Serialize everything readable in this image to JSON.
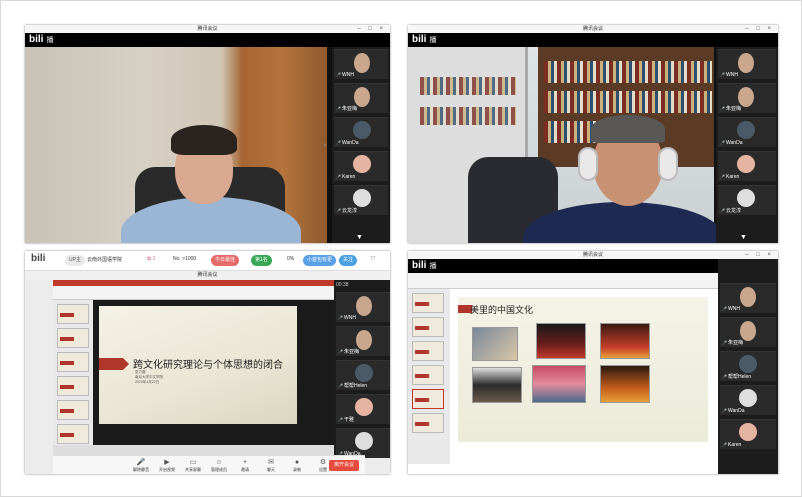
{
  "screens": [
    {
      "window_title": "腾讯会议",
      "bili_logo": "bili",
      "bili_suffix": "播",
      "participants": [
        "WNH",
        "朱亚梅",
        "WanDa",
        "Karen",
        "云龙淳"
      ]
    },
    {
      "window_title": "腾讯会议",
      "bili_logo": "bili",
      "bili_suffix": "播",
      "participants": [
        "WNH",
        "朱亚梅",
        "WanDa",
        "Karen",
        "云龙淳"
      ]
    },
    {
      "bili_logo": "bili",
      "live_badge": "UP主",
      "room_name": "云南外国语学院",
      "count_left": "1",
      "count_no": "No. >1000",
      "gift_pill": "今日最佳",
      "rank_pill": "第1名",
      "progress": "0%",
      "pill_small": "小首包有更",
      "follow_btn": "关注",
      "fans": "77",
      "window_title": "腾讯会议",
      "time_display": "00:38",
      "slide_title": "跨文化研究理论与个体思想的闭合",
      "slide_sub_1": "张力磊",
      "slide_sub_2": "南京大学中文学院",
      "slide_sub_3": "2020年4月22日",
      "participants": [
        "WNH",
        "朱亚梅",
        "帮帮Helen",
        "干雅",
        "WanDa"
      ],
      "toolbar": [
        "解除静音",
        "开启视频",
        "共享屏幕",
        "管理成员",
        "邀请",
        "聊天",
        "录制",
        "设置"
      ],
      "end_button": "离开会议"
    },
    {
      "window_title": "腾讯会议",
      "bili_logo": "bili",
      "bili_suffix": "播",
      "slide_title": "美里的中国文化",
      "participants": [
        "WNH",
        "朱亚梅",
        "帮帮Helen",
        "WanDa",
        "Karen"
      ]
    }
  ],
  "colors": {
    "accent_red": "#b0352a",
    "end_red": "#e64a3c",
    "panel_bg": "#1c1c1c"
  }
}
